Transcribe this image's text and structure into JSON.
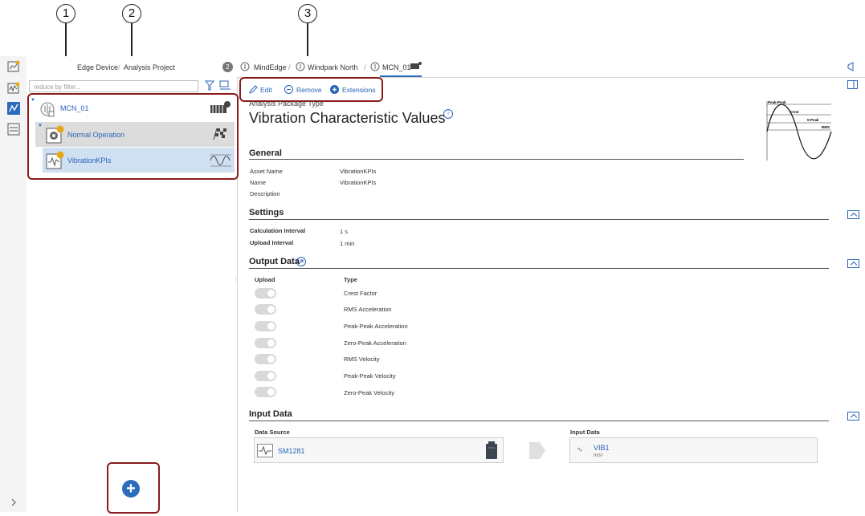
{
  "callouts": [
    "1",
    "2",
    "3"
  ],
  "rail": {
    "icons": [
      "dashboard-icon",
      "chart-icon",
      "analysis-icon",
      "project-icon"
    ],
    "expand_icon": "chevron-right-icon"
  },
  "topbar": {
    "left_crumbs": [
      "Edge Device",
      "Analysis Project"
    ],
    "badge": "2",
    "crumbs": [
      "MindEdge",
      "Windpark North",
      "MCN_01"
    ]
  },
  "tree": {
    "filter_placeholder": "reduce by filter...",
    "items": [
      {
        "label": "MCN_01",
        "icon": "asset-icon"
      },
      {
        "label": "Normal Operation",
        "icon": "gear-icon"
      },
      {
        "label": "VibrationKPIs",
        "icon": "vibration-icon"
      }
    ]
  },
  "toolbar": {
    "edit": "Edit",
    "remove": "Remove",
    "extensions": "Extensions"
  },
  "header": {
    "subtitle": "Analysis Package Type",
    "title": "Vibration Characteristic Values",
    "info": "i"
  },
  "diagram": {
    "labels": [
      "Peak-Peak",
      "Crest",
      "0-Peak",
      "RMS"
    ]
  },
  "general": {
    "title": "General",
    "fields": [
      {
        "label": "Asset Name",
        "value": "VibrationKPIs"
      },
      {
        "label": "Name",
        "value": "VibrationKPIs"
      },
      {
        "label": "Description",
        "value": ""
      }
    ]
  },
  "settings": {
    "title": "Settings",
    "fields": [
      {
        "label": "Calculation Interval",
        "value": "1 s"
      },
      {
        "label": "Upload Interval",
        "value": "1 min"
      }
    ]
  },
  "output": {
    "title": "Output Data",
    "col_upload": "Upload",
    "col_type": "Type",
    "rows": [
      "Crest Factor",
      "RMS Acceleration",
      "Peak-Peak Acceleration",
      "Zero-Peak Acceleration",
      "RMS Velocity",
      "Peak-Peak Velocity",
      "Zero-Peak Velocity"
    ]
  },
  "input": {
    "title": "Input Data",
    "source_label": "Data Source",
    "source_value": "SM1281",
    "input_label": "Input Data",
    "input_value": "VIB1",
    "input_unit": "m/s²"
  }
}
